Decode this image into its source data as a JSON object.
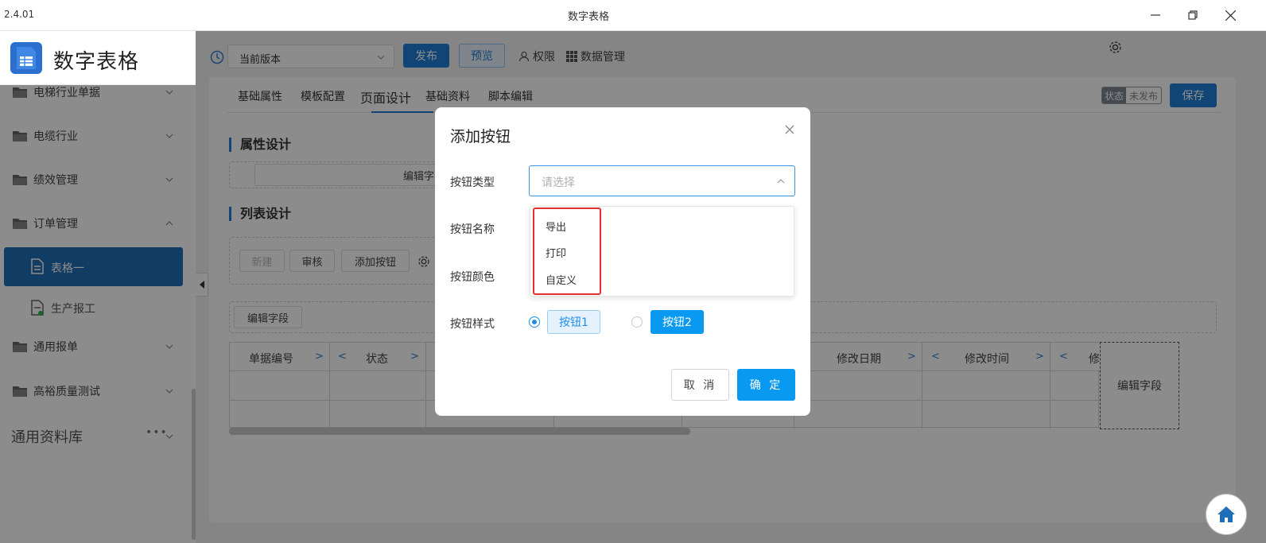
{
  "window": {
    "version": "2.4.01",
    "title": "数字表格",
    "min_icon": "minimize-icon",
    "restore_icon": "restore-icon",
    "close_icon": "close-icon"
  },
  "sidebar": {
    "app_name": "数字表格",
    "items": [
      {
        "label": "电梯行业单据",
        "icon": "folder-icon",
        "chevron": "chevron-down-icon"
      },
      {
        "label": "电缆行业",
        "icon": "folder-icon",
        "chevron": "chevron-down-icon"
      },
      {
        "label": "绩效管理",
        "icon": "folder-icon",
        "chevron": "chevron-down-icon"
      },
      {
        "label": "订单管理",
        "icon": "folder-icon",
        "chevron": "chevron-up-icon"
      },
      {
        "label": "表格一",
        "icon": "document-icon",
        "active": true
      },
      {
        "label": "生产报工",
        "icon": "document-icon"
      },
      {
        "label": "通用报单",
        "icon": "folder-icon",
        "chevron": "chevron-down-icon"
      },
      {
        "label": "高裕质量测试",
        "icon": "folder-icon",
        "chevron": "chevron-down-icon"
      }
    ],
    "library": {
      "label": "通用资料库",
      "more_icon": "more-icon"
    }
  },
  "toolbar": {
    "version_value": "当前版本",
    "publish_label": "发布",
    "preview_label": "预览",
    "permission_label": "权限",
    "data_manage_label": "数据管理"
  },
  "tabs": [
    "基础属性",
    "模板配置",
    "页面设计",
    "基础资料",
    "脚本编辑"
  ],
  "active_tab": "页面设计",
  "status": {
    "key": "状态",
    "value": "未发布"
  },
  "save_label": "保存",
  "page": {
    "attr_section": "属性设计",
    "attr_edit_field": "编辑字",
    "list_section": "列表设计",
    "btn_new": "新建",
    "btn_audit": "审核",
    "btn_add_button": "添加按钮",
    "edit_field": "编辑字段",
    "columns": [
      "单据编号",
      "状态",
      "修改日期",
      "修改时间",
      "修"
    ],
    "edit_field_box": "编辑字段"
  },
  "modal": {
    "title": "添加按钮",
    "type_label": "按钮类型",
    "type_placeholder": "请选择",
    "name_label": "按钮名称",
    "color_label": "按钮颜色",
    "style_label": "按钮样式",
    "options": [
      "导出",
      "打印",
      "自定义"
    ],
    "style_1": "按钮1",
    "style_2": "按钮2",
    "selected_style": "按钮1",
    "cancel_label": "取 消",
    "ok_label": "确 定"
  },
  "colors": {
    "primary": "#1f7fd8",
    "accent": "#0a99f0",
    "highlight": "#e52e2e",
    "sidebar_active": "#1f6fb8"
  }
}
